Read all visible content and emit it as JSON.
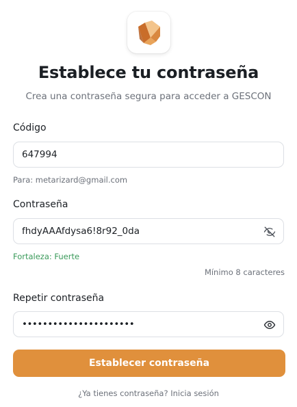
{
  "brand": {
    "logo_colors": [
      "#e9a45a",
      "#c96d2a",
      "#f3c48b",
      "#d9883f"
    ]
  },
  "header": {
    "title": "Establece tu contraseña",
    "subtitle": "Crea una contraseña segura para acceder a GESCON"
  },
  "code_field": {
    "label": "Código",
    "value": "647994",
    "hint": "Para: metarizard@gmail.com"
  },
  "password_field": {
    "label": "Contraseña",
    "value": "fhdyAAAfdysa6!8r92_0da",
    "visibility_icon": "eye-off-icon",
    "strength_text": "Fortaleza: Fuerte",
    "strength_color": "#3a9a5a",
    "min_chars_text": "Mínimo 8 caracteres"
  },
  "repeat_field": {
    "label": "Repetir contraseña",
    "value": "••••••••••••••••••••••",
    "visibility_icon": "eye-icon"
  },
  "submit": {
    "label": "Establecer contraseña",
    "color": "#e0903c"
  },
  "footer": {
    "text": "¿Ya tienes contraseña? Inicia sesión"
  }
}
